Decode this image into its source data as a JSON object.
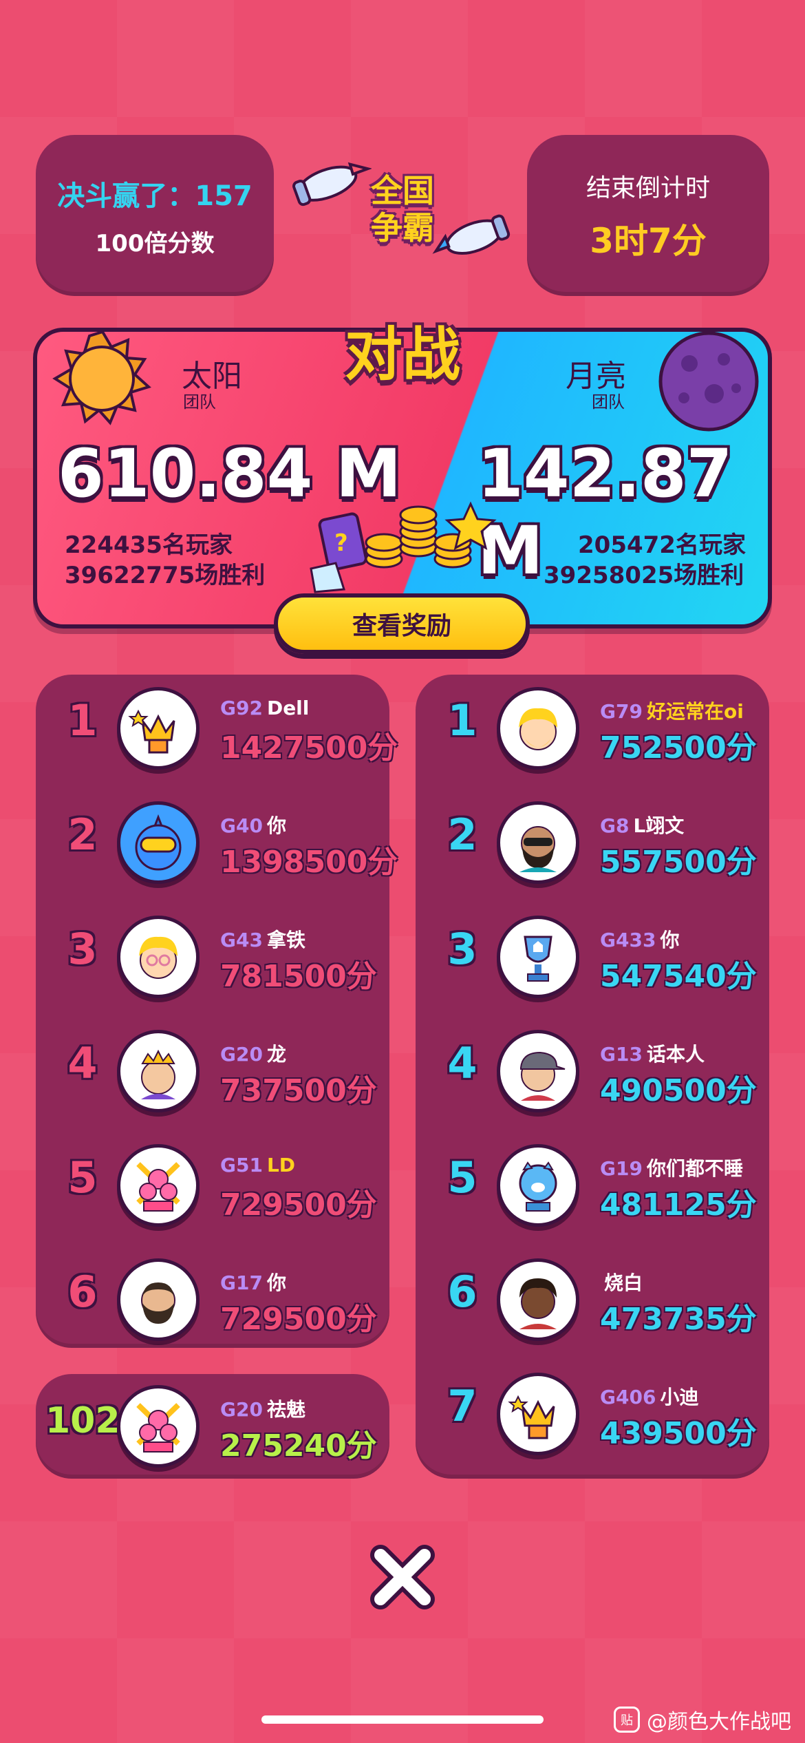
{
  "header": {
    "duel_label": "决斗赢了：",
    "duel_count": "157",
    "multiplier": "100倍分数",
    "event_title_line1": "全国",
    "event_title_line2": "争霸",
    "countdown_label": "结束倒计时",
    "countdown_value": "3时7分"
  },
  "battle": {
    "title": "对战",
    "sun": {
      "name": "太阳",
      "sub": "团队",
      "score": "610.84 M",
      "players": "224435名玩家",
      "wins": "39622775场胜利"
    },
    "moon": {
      "name": "月亮",
      "sub": "团队",
      "score": "142.87 M",
      "players": "205472名玩家",
      "wins": "39258025场胜利"
    },
    "reward_button": "查看奖励"
  },
  "sun_board": [
    {
      "rank": "1",
      "level": "G92",
      "name": "Dell",
      "score": "1427500分",
      "avatar": "crown-trophy-icon"
    },
    {
      "rank": "2",
      "level": "G40",
      "name": "你",
      "score": "1398500分",
      "avatar": "blue-goggle-avatar"
    },
    {
      "rank": "3",
      "level": "G43",
      "name": "拿铁",
      "score": "781500分",
      "avatar": "blonde-avatar"
    },
    {
      "rank": "4",
      "level": "G20",
      "name": "龙",
      "score": "737500分",
      "avatar": "crowned-avatar"
    },
    {
      "rank": "5",
      "level": "G51",
      "name": "LD",
      "score": "729500分",
      "avatar": "pink-skull-trophy-icon"
    },
    {
      "rank": "6",
      "level": "G17",
      "name": "你",
      "score": "729500分",
      "avatar": "bearded-avatar"
    }
  ],
  "self_entry": {
    "rank": "102",
    "level": "G20",
    "name": "祛魅",
    "score": "275240分",
    "avatar": "pink-skull-trophy-icon"
  },
  "moon_board": [
    {
      "rank": "1",
      "level": "G79",
      "name": "好运常在oi",
      "score": "752500分",
      "avatar": "blonde-avatar"
    },
    {
      "rank": "2",
      "level": "G8",
      "name": "L翊文",
      "score": "557500分",
      "avatar": "sunglasses-avatar"
    },
    {
      "rank": "3",
      "level": "G433",
      "name": "你",
      "score": "547540分",
      "avatar": "blue-trophy-icon"
    },
    {
      "rank": "4",
      "level": "G13",
      "name": "话本人",
      "score": "490500分",
      "avatar": "cap-avatar"
    },
    {
      "rank": "5",
      "level": "G19",
      "name": "你们都不睡",
      "score": "481125分",
      "avatar": "blue-pig-trophy-icon"
    },
    {
      "rank": "6",
      "level": "",
      "name": "烧白",
      "score": "473735分",
      "avatar": "curly-hair-avatar"
    },
    {
      "rank": "7",
      "level": "G406",
      "name": "小迪",
      "score": "439500分",
      "avatar": "crown-trophy-icon"
    }
  ],
  "watermark": {
    "logo": "贴",
    "text": "@颜色大作战吧"
  },
  "colors": {
    "sun_team": "#f23b66",
    "moon_team": "#22d6f2",
    "panel": "#8f2758",
    "accent_yellow": "#ffd21e",
    "outline": "#3d1140"
  }
}
